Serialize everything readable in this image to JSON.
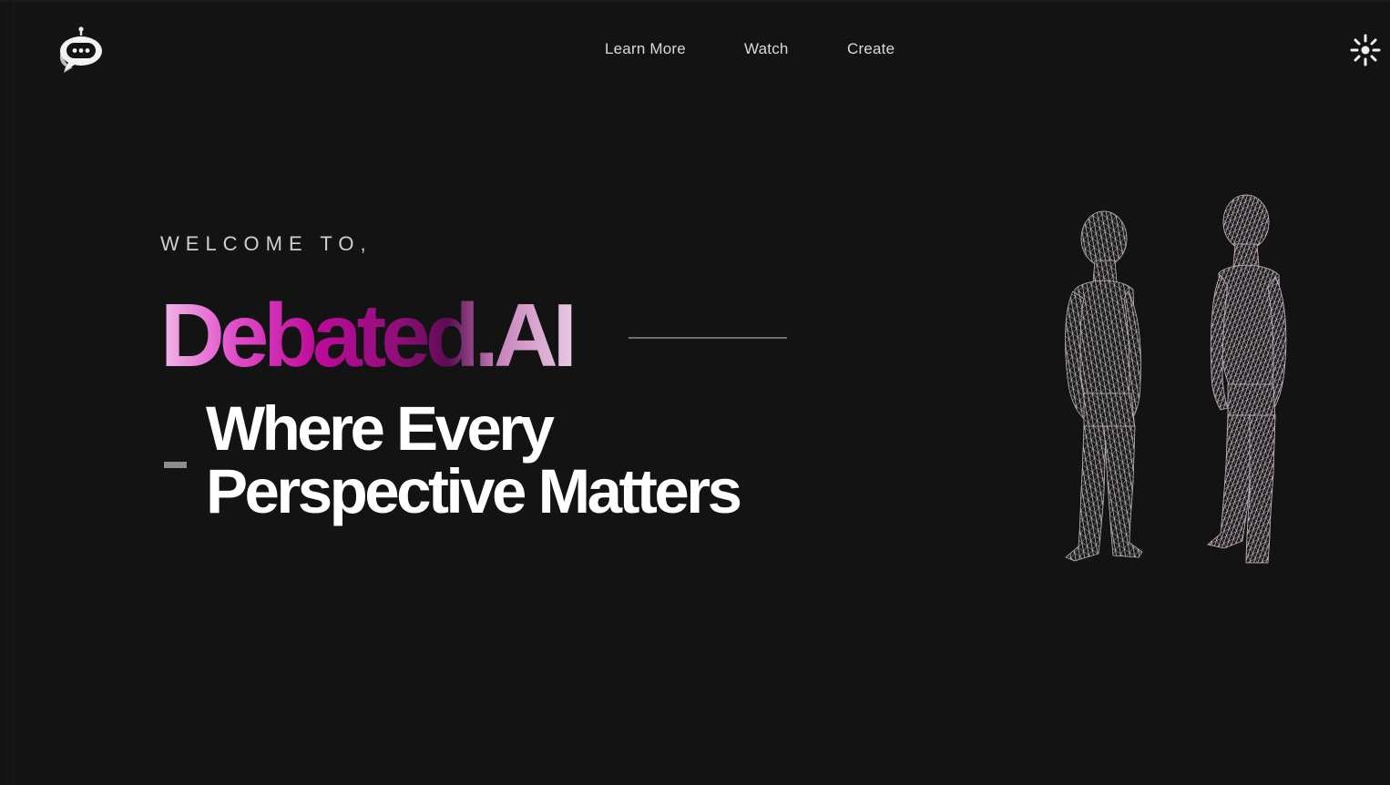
{
  "header": {
    "logo_icon": "robot-chat-icon",
    "nav": [
      {
        "label": "Learn More"
      },
      {
        "label": "Watch"
      },
      {
        "label": "Create"
      }
    ],
    "theme_toggle_icon": "sun-icon"
  },
  "hero": {
    "welcome": "WELCOME TO,",
    "brand": "Debated.AI",
    "tagline_line1": "Where Every",
    "tagline_line2": "Perspective Matters",
    "illustration_icon": "wireframe-figures-icon"
  },
  "colors": {
    "background": "#131313",
    "brand_gradient_start": "#f3b8ea",
    "brand_gradient_mid": "#bd0a9a",
    "brand_gradient_dark": "#5c0c52",
    "text": "#ffffff",
    "nav_text": "#d9d9d9"
  }
}
